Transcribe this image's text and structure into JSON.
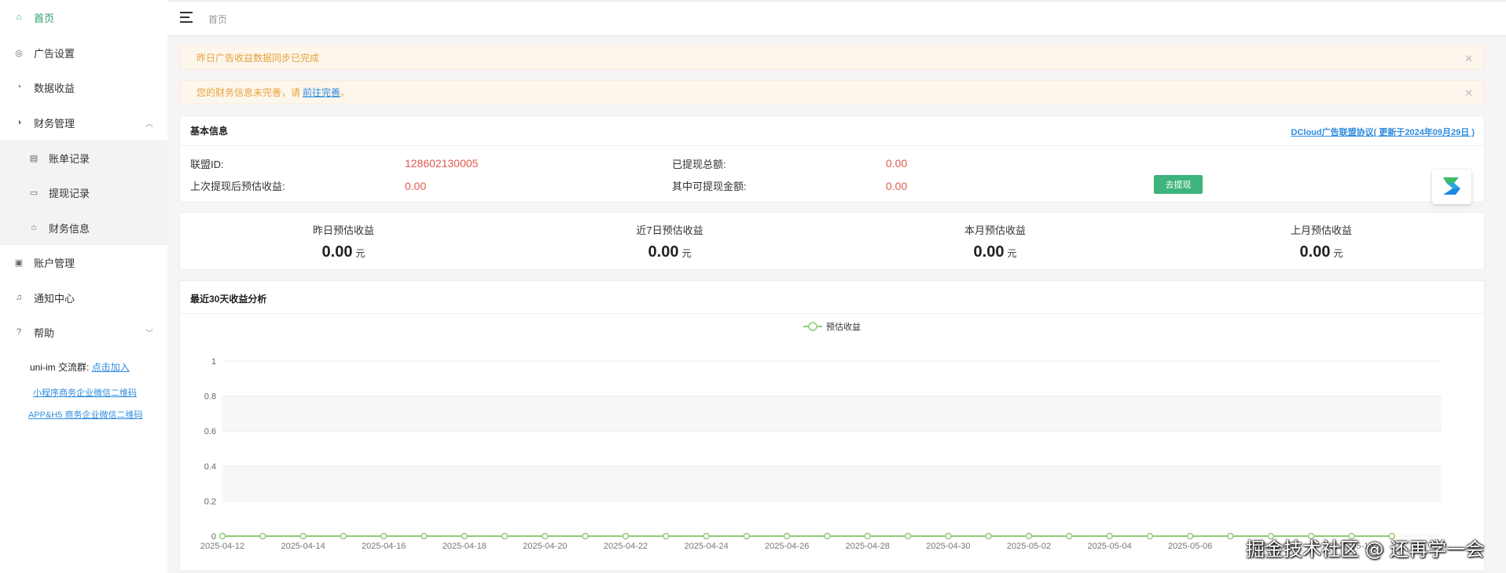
{
  "sidebar": {
    "items": [
      {
        "label": "首页",
        "icon": "home-icon",
        "active": true
      },
      {
        "label": "广告设置",
        "icon": "target-icon"
      },
      {
        "label": "数据收益",
        "icon": "gauge-icon"
      },
      {
        "label": "财务管理",
        "icon": "finance-icon",
        "expanded": true
      },
      {
        "label": "账单记录",
        "icon": "bill-icon",
        "sub": true
      },
      {
        "label": "提现记录",
        "icon": "wallet-icon",
        "sub": true
      },
      {
        "label": "财务信息",
        "icon": "bank-icon",
        "sub": true
      },
      {
        "label": "账户管理",
        "icon": "account-icon"
      },
      {
        "label": "通知中心",
        "icon": "bell-icon"
      },
      {
        "label": "帮助",
        "icon": "help-icon",
        "expanded": false
      }
    ],
    "qq_group_label": "uni-im 交流群:",
    "qq_group_link": "点击加入",
    "link_miniprogram": "小程序商务企业微信二维码",
    "link_app_h5": "APP&H5 商务企业微信二维码"
  },
  "header": {
    "breadcrumb": "首页"
  },
  "alerts": [
    {
      "text": "昨日广告收益数据同步已完成",
      "link": ""
    },
    {
      "text": "您的财务信息未完善，请",
      "link": "前往完善",
      "suffix": "。"
    }
  ],
  "basic_info": {
    "title": "基本信息",
    "agreement_link": "DCloud广告联盟协议( 更新于2024年09月29日 )",
    "union_id_label": "联盟ID:",
    "union_id": "128602130005",
    "withdrawn_total_label": "已提现总额:",
    "withdrawn_total": "0.00",
    "since_last_label": "上次提现后预估收益:",
    "since_last": "0.00",
    "withdrawable_label": "其中可提现金额:",
    "withdrawable": "0.00",
    "withdraw_button": "去提现"
  },
  "stats": [
    {
      "label": "昨日预估收益",
      "value": "0.00",
      "unit": "元"
    },
    {
      "label": "近7日预估收益",
      "value": "0.00",
      "unit": "元"
    },
    {
      "label": "本月预估收益",
      "value": "0.00",
      "unit": "元"
    },
    {
      "label": "上月预估收益",
      "value": "0.00",
      "unit": "元"
    }
  ],
  "chart_section_title": "最近30天收益分析",
  "colors": {
    "accent": "#2a9d6b",
    "line": "#91cc75",
    "value_red": "#e05a4f",
    "link": "#2f8ce0",
    "alert_text": "#e6a23c"
  },
  "chart_data": {
    "type": "line",
    "legend_position": "top-center",
    "ylim": [
      0,
      1
    ],
    "yticks": [
      "0",
      "0.2",
      "0.4",
      "0.6",
      "0.8",
      "1"
    ],
    "xtick_labels": [
      "2025-04-12",
      "2025-04-14",
      "2025-04-16",
      "2025-04-18",
      "2025-04-20",
      "2025-04-22",
      "2025-04-24",
      "2025-04-26",
      "2025-04-28",
      "2025-04-30",
      "2025-05-02",
      "2025-05-04",
      "2025-05-06",
      "2025-05-08",
      "2025-05-10"
    ],
    "x": [
      "2025-04-12",
      "2025-04-13",
      "2025-04-14",
      "2025-04-15",
      "2025-04-16",
      "2025-04-17",
      "2025-04-18",
      "2025-04-19",
      "2025-04-20",
      "2025-04-21",
      "2025-04-22",
      "2025-04-23",
      "2025-04-24",
      "2025-04-25",
      "2025-04-26",
      "2025-04-27",
      "2025-04-28",
      "2025-04-29",
      "2025-04-30",
      "2025-05-01",
      "2025-05-02",
      "2025-05-03",
      "2025-05-04",
      "2025-05-05",
      "2025-05-06",
      "2025-05-07",
      "2025-05-08",
      "2025-05-09",
      "2025-05-10",
      "2025-05-11"
    ],
    "series": [
      {
        "name": "预估收益",
        "values": [
          0,
          0,
          0,
          0,
          0,
          0,
          0,
          0,
          0,
          0,
          0,
          0,
          0,
          0,
          0,
          0,
          0,
          0,
          0,
          0,
          0,
          0,
          0,
          0,
          0,
          0,
          0,
          0,
          0,
          0
        ]
      }
    ]
  },
  "watermark": "掘金技术社区 @ 还再学一会"
}
